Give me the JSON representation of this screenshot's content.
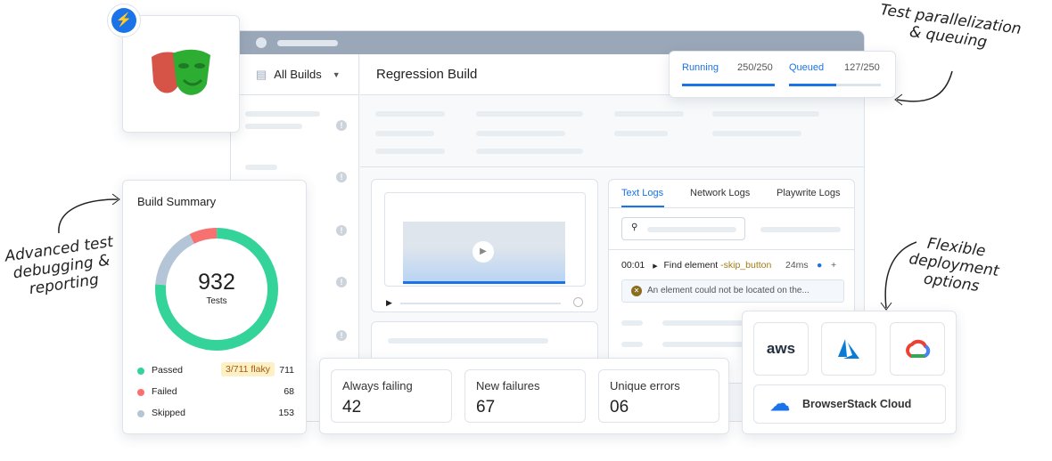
{
  "window": {
    "sidebar_title": "All Builds",
    "build_title": "Regression Build"
  },
  "queue": {
    "running_label": "Running",
    "running_value": "250/250",
    "running_fill": 1.0,
    "queued_label": "Queued",
    "queued_value": "127/250",
    "queued_fill": 0.508
  },
  "logs": {
    "tabs": [
      "Text Logs",
      "Network Logs",
      "Playwrite Logs"
    ],
    "active_tab": "Text Logs",
    "time": "00:01",
    "step": "Find element",
    "selector": "-skip_button",
    "duration": "24ms",
    "error": "An element could not be located on the..."
  },
  "summary": {
    "title": "Build Summary",
    "total": "932",
    "total_label": "Tests",
    "rows": [
      {
        "label": "Passed",
        "badge": "3/711 flaky",
        "value": "711",
        "color": "#34d399"
      },
      {
        "label": "Failed",
        "value": "68",
        "color": "#f87171"
      },
      {
        "label": "Skipped",
        "value": "153",
        "color": "#b3c5d7"
      }
    ]
  },
  "metrics": [
    {
      "label": "Always failing",
      "value": "42"
    },
    {
      "label": "New failures",
      "value": "67"
    },
    {
      "label": "Unique errors",
      "value": "06"
    }
  ],
  "deploy": {
    "aws": "aws",
    "cloud": "BrowserStack Cloud"
  },
  "annotations": {
    "parallel": "Test parallelization & queuing",
    "debug": "Advanced test debugging & reporting",
    "deploy": "Flexible deployment options"
  },
  "colors": {
    "accent": "#1a73e8",
    "green": "#34d399",
    "red": "#f87171",
    "gray": "#b3c5d7"
  }
}
